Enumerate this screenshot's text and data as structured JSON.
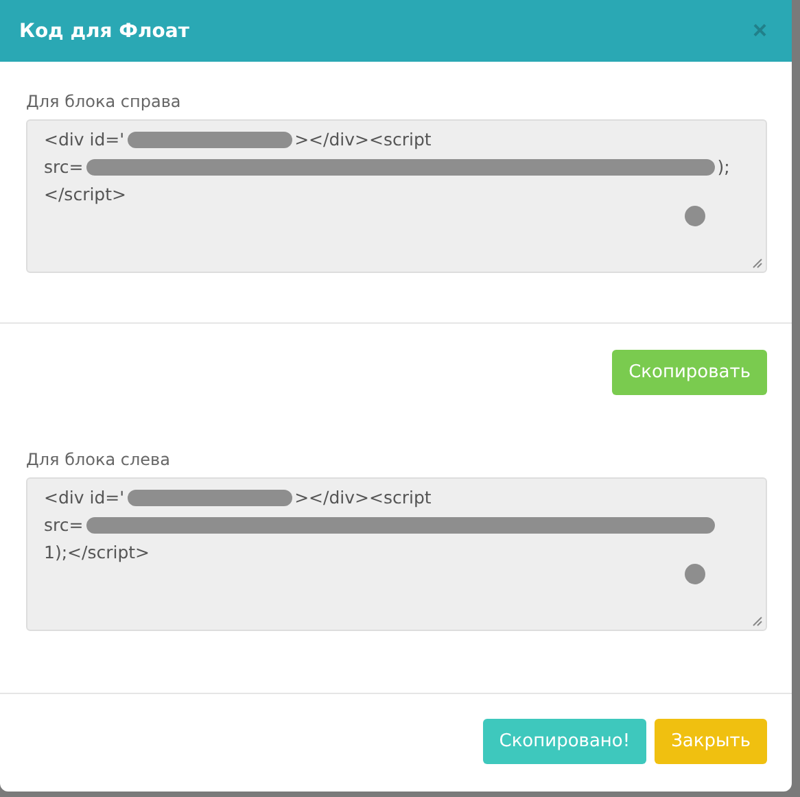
{
  "dialog": {
    "title": "Код для Флоат",
    "close": "×"
  },
  "sections": [
    {
      "label": "Для блока справа",
      "lines": [
        [
          {
            "kind": "text",
            "text": "<div id='"
          },
          {
            "kind": "redacted"
          },
          {
            "kind": "text",
            "text": "></div><script"
          }
        ],
        [
          {
            "kind": "text",
            "text": "src="
          },
          {
            "kind": "redacted",
            "wide": true
          },
          {
            "kind": "text",
            "text": ");"
          }
        ],
        [
          {
            "kind": "text",
            "text": "</script>"
          }
        ]
      ],
      "button": {
        "label": "Скопировать",
        "kind": "green"
      }
    },
    {
      "label": "Для блока слева",
      "lines": [
        [
          {
            "kind": "text",
            "text": "<div id='"
          },
          {
            "kind": "redacted"
          },
          {
            "kind": "text",
            "text": "></div><script"
          }
        ],
        [
          {
            "kind": "text",
            "text": "src="
          },
          {
            "kind": "redacted",
            "wide": true
          }
        ],
        [
          {
            "kind": "text",
            "text": "1);</script>"
          }
        ]
      ]
    }
  ],
  "footer_buttons": [
    {
      "label": "Скопировано!",
      "kind": "teal"
    },
    {
      "label": "Закрыть",
      "kind": "yellow"
    }
  ]
}
